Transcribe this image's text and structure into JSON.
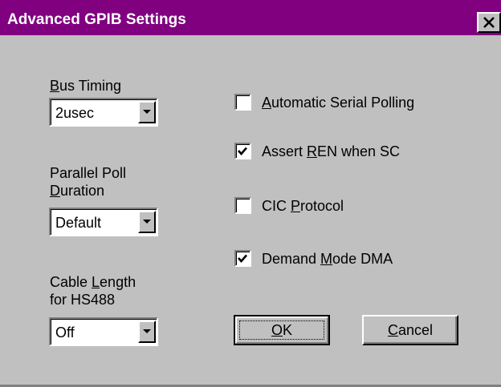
{
  "window": {
    "title": "Advanced GPIB Settings",
    "title_bar_color": "#800080"
  },
  "left_panel": {
    "bus_timing": {
      "label_mnemonic": "B",
      "label_rest": "us Timing",
      "value": "2usec"
    },
    "parallel_poll": {
      "label_line1": "Parallel Poll",
      "label_line2_mnemonic": "D",
      "label_line2_rest": "uration",
      "value": "Default"
    },
    "cable_length": {
      "label_line1_pre": "Cable ",
      "label_line1_mnemonic": "L",
      "label_line1_rest": "ength",
      "label_line2": "for HS488",
      "value": "Off"
    }
  },
  "options": {
    "auto_serial_polling": {
      "checked": false,
      "label_mnemonic": "A",
      "label_rest": "utomatic Serial Polling"
    },
    "assert_ren": {
      "checked": true,
      "label_pre": "Assert ",
      "label_mnemonic": "R",
      "label_rest": "EN when SC"
    },
    "cic_protocol": {
      "checked": false,
      "label_pre": "CIC ",
      "label_mnemonic": "P",
      "label_rest": "rotocol"
    },
    "demand_mode_dma": {
      "checked": true,
      "label_pre": "Demand ",
      "label_mnemonic": "M",
      "label_rest": "ode DMA"
    }
  },
  "buttons": {
    "ok_mnemonic": "O",
    "ok_rest": "K",
    "cancel_mnemonic": "C",
    "cancel_rest": "ancel"
  },
  "icons": {
    "close": "close-icon",
    "dropdown": "chevron-down-icon",
    "check": "checkmark-icon"
  }
}
